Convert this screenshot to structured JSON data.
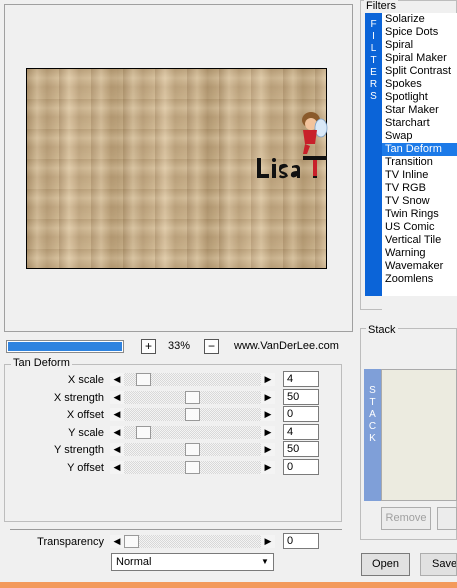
{
  "zoom": {
    "percent_label": "33%",
    "plus_label": "+",
    "minus_label": "−",
    "progress": 1.0,
    "progress_color": "#2f83df"
  },
  "website": "www.VanDerLee.com",
  "watermark": {
    "text": "Lisa T",
    "kind": "logo-signature"
  },
  "filters": {
    "title": "Filters",
    "strip_letters": [
      "F",
      "I",
      "L",
      "T",
      "E",
      "R",
      "S"
    ],
    "accent_color": "#0b64d8",
    "selected_index": 10,
    "items": [
      "Solarize",
      "Spice Dots",
      "Spiral",
      "Spiral Maker",
      "Split Contrast",
      "Spokes",
      "Spotlight",
      "Star Maker",
      "Starchart",
      "Swap",
      "Tan Deform",
      "Transition",
      "TV Inline",
      "TV RGB",
      "TV Snow",
      "Twin Rings",
      "US Comic",
      "Vertical Tile",
      "Warning",
      "Wavemaker",
      "Zoomlens"
    ]
  },
  "stack": {
    "title": "Stack",
    "strip_letters": [
      "S",
      "T",
      "A",
      "C",
      "K"
    ],
    "remove_label": "Remove"
  },
  "params": {
    "title": "Tan Deform",
    "rows": [
      {
        "label": "X scale",
        "value": "4",
        "level": 0.1
      },
      {
        "label": "X strength",
        "value": "50",
        "level": 0.5
      },
      {
        "label": "X offset",
        "value": "0",
        "level": 0.5
      },
      {
        "label": "Y scale",
        "value": "4",
        "level": 0.1
      },
      {
        "label": "Y strength",
        "value": "50",
        "level": 0.5
      },
      {
        "label": "Y offset",
        "value": "0",
        "level": 0.5
      }
    ]
  },
  "transparency": {
    "label": "Transparency",
    "value": "0",
    "level": 0.0
  },
  "blend": {
    "selected": "Normal"
  },
  "buttons": {
    "open_label": "Open",
    "save_label": "Save"
  }
}
